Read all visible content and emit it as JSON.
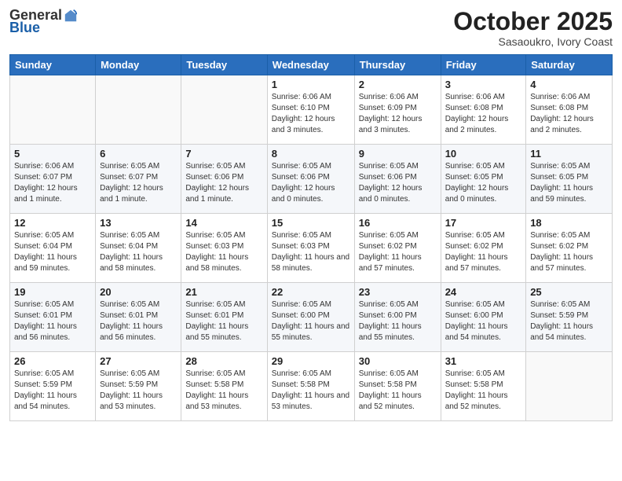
{
  "header": {
    "logo_general": "General",
    "logo_blue": "Blue",
    "month": "October 2025",
    "location": "Sasaoukro, Ivory Coast"
  },
  "weekdays": [
    "Sunday",
    "Monday",
    "Tuesday",
    "Wednesday",
    "Thursday",
    "Friday",
    "Saturday"
  ],
  "weeks": [
    [
      {
        "day": "",
        "info": ""
      },
      {
        "day": "",
        "info": ""
      },
      {
        "day": "",
        "info": ""
      },
      {
        "day": "1",
        "info": "Sunrise: 6:06 AM\nSunset: 6:10 PM\nDaylight: 12 hours and 3 minutes."
      },
      {
        "day": "2",
        "info": "Sunrise: 6:06 AM\nSunset: 6:09 PM\nDaylight: 12 hours and 3 minutes."
      },
      {
        "day": "3",
        "info": "Sunrise: 6:06 AM\nSunset: 6:08 PM\nDaylight: 12 hours and 2 minutes."
      },
      {
        "day": "4",
        "info": "Sunrise: 6:06 AM\nSunset: 6:08 PM\nDaylight: 12 hours and 2 minutes."
      }
    ],
    [
      {
        "day": "5",
        "info": "Sunrise: 6:06 AM\nSunset: 6:07 PM\nDaylight: 12 hours and 1 minute."
      },
      {
        "day": "6",
        "info": "Sunrise: 6:05 AM\nSunset: 6:07 PM\nDaylight: 12 hours and 1 minute."
      },
      {
        "day": "7",
        "info": "Sunrise: 6:05 AM\nSunset: 6:06 PM\nDaylight: 12 hours and 1 minute."
      },
      {
        "day": "8",
        "info": "Sunrise: 6:05 AM\nSunset: 6:06 PM\nDaylight: 12 hours and 0 minutes."
      },
      {
        "day": "9",
        "info": "Sunrise: 6:05 AM\nSunset: 6:06 PM\nDaylight: 12 hours and 0 minutes."
      },
      {
        "day": "10",
        "info": "Sunrise: 6:05 AM\nSunset: 6:05 PM\nDaylight: 12 hours and 0 minutes."
      },
      {
        "day": "11",
        "info": "Sunrise: 6:05 AM\nSunset: 6:05 PM\nDaylight: 11 hours and 59 minutes."
      }
    ],
    [
      {
        "day": "12",
        "info": "Sunrise: 6:05 AM\nSunset: 6:04 PM\nDaylight: 11 hours and 59 minutes."
      },
      {
        "day": "13",
        "info": "Sunrise: 6:05 AM\nSunset: 6:04 PM\nDaylight: 11 hours and 58 minutes."
      },
      {
        "day": "14",
        "info": "Sunrise: 6:05 AM\nSunset: 6:03 PM\nDaylight: 11 hours and 58 minutes."
      },
      {
        "day": "15",
        "info": "Sunrise: 6:05 AM\nSunset: 6:03 PM\nDaylight: 11 hours and 58 minutes."
      },
      {
        "day": "16",
        "info": "Sunrise: 6:05 AM\nSunset: 6:02 PM\nDaylight: 11 hours and 57 minutes."
      },
      {
        "day": "17",
        "info": "Sunrise: 6:05 AM\nSunset: 6:02 PM\nDaylight: 11 hours and 57 minutes."
      },
      {
        "day": "18",
        "info": "Sunrise: 6:05 AM\nSunset: 6:02 PM\nDaylight: 11 hours and 57 minutes."
      }
    ],
    [
      {
        "day": "19",
        "info": "Sunrise: 6:05 AM\nSunset: 6:01 PM\nDaylight: 11 hours and 56 minutes."
      },
      {
        "day": "20",
        "info": "Sunrise: 6:05 AM\nSunset: 6:01 PM\nDaylight: 11 hours and 56 minutes."
      },
      {
        "day": "21",
        "info": "Sunrise: 6:05 AM\nSunset: 6:01 PM\nDaylight: 11 hours and 55 minutes."
      },
      {
        "day": "22",
        "info": "Sunrise: 6:05 AM\nSunset: 6:00 PM\nDaylight: 11 hours and 55 minutes."
      },
      {
        "day": "23",
        "info": "Sunrise: 6:05 AM\nSunset: 6:00 PM\nDaylight: 11 hours and 55 minutes."
      },
      {
        "day": "24",
        "info": "Sunrise: 6:05 AM\nSunset: 6:00 PM\nDaylight: 11 hours and 54 minutes."
      },
      {
        "day": "25",
        "info": "Sunrise: 6:05 AM\nSunset: 5:59 PM\nDaylight: 11 hours and 54 minutes."
      }
    ],
    [
      {
        "day": "26",
        "info": "Sunrise: 6:05 AM\nSunset: 5:59 PM\nDaylight: 11 hours and 54 minutes."
      },
      {
        "day": "27",
        "info": "Sunrise: 6:05 AM\nSunset: 5:59 PM\nDaylight: 11 hours and 53 minutes."
      },
      {
        "day": "28",
        "info": "Sunrise: 6:05 AM\nSunset: 5:58 PM\nDaylight: 11 hours and 53 minutes."
      },
      {
        "day": "29",
        "info": "Sunrise: 6:05 AM\nSunset: 5:58 PM\nDaylight: 11 hours and 53 minutes."
      },
      {
        "day": "30",
        "info": "Sunrise: 6:05 AM\nSunset: 5:58 PM\nDaylight: 11 hours and 52 minutes."
      },
      {
        "day": "31",
        "info": "Sunrise: 6:05 AM\nSunset: 5:58 PM\nDaylight: 11 hours and 52 minutes."
      },
      {
        "day": "",
        "info": ""
      }
    ]
  ]
}
